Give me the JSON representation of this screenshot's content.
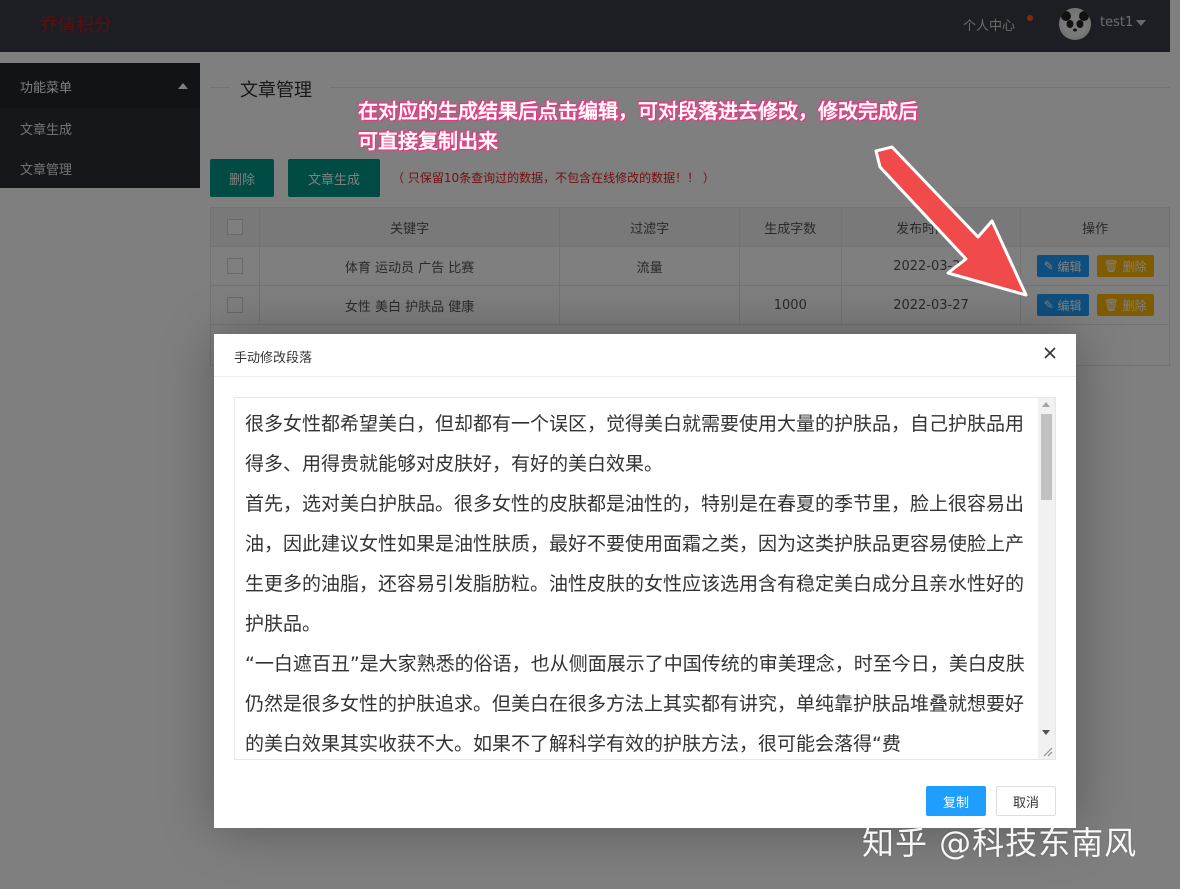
{
  "header": {
    "logo_text": "乔倩积分",
    "user_center": "个人中心",
    "username": "test1"
  },
  "sidebar": {
    "title": "功能菜单",
    "items": [
      {
        "label": "文章生成"
      },
      {
        "label": "文章管理"
      }
    ]
  },
  "main": {
    "section_title": "文章管理",
    "annotation": "在对应的生成结果后点击编辑，可对段落进去修改，修改完成后\n可直接复制出来",
    "toolbar": {
      "delete_label": "删除",
      "generate_label": "文章生成",
      "note": "（ 只保留10条查询过的数据，不包含在线修改的数据！！ ）"
    },
    "table": {
      "headers": [
        "关键字",
        "过滤字",
        "生成字数",
        "发布时间",
        "操作"
      ],
      "rows": [
        {
          "keywords": "体育 运动员 广告 比赛",
          "filter": "流量",
          "count": "",
          "date": "2022-03-27"
        },
        {
          "keywords": "女性 美白 护肤品 健康",
          "filter": "",
          "count": "1000",
          "date": "2022-03-27"
        }
      ],
      "edit_label": "编辑",
      "delete_label": "删除"
    }
  },
  "modal": {
    "title": "手动修改段落",
    "content": "很多女性都希望美白，但却都有一个误区，觉得美白就需要使用大量的护肤品，自己护肤品用得多、用得贵就能够对皮肤好，有好的美白效果。\n首先，选对美白护肤品。很多女性的皮肤都是油性的，特别是在春夏的季节里，脸上很容易出油，因此建议女性如果是油性肤质，最好不要使用面霜之类，因为这类护肤品更容易使脸上产生更多的油脂，还容易引发脂肪粒。油性皮肤的女性应该选用含有稳定美白成分且亲水性好的护肤品。\n“一白遮百丑”是大家熟悉的俗语，也从侧面展示了中国传统的审美理念，时至今日，美白皮肤仍然是很多女性的护肤追求。但美白在很多方法上其实都有讲究，单纯靠护肤品堆叠就想要好的美白效果其实收获不大。如果不了解科学有效的护肤方法，很可能会落得“费",
    "copy_label": "复制",
    "cancel_label": "取消"
  },
  "watermark": "知乎 @科技东南风",
  "colors": {
    "topbar": "#393d49",
    "sidebar": "#2b2e37",
    "primary_green": "#009688",
    "primary_blue": "#1e9fff",
    "warning_yellow": "#ffb800",
    "annotation_pink": "#ff3b8c",
    "note_red": "#e52020"
  }
}
